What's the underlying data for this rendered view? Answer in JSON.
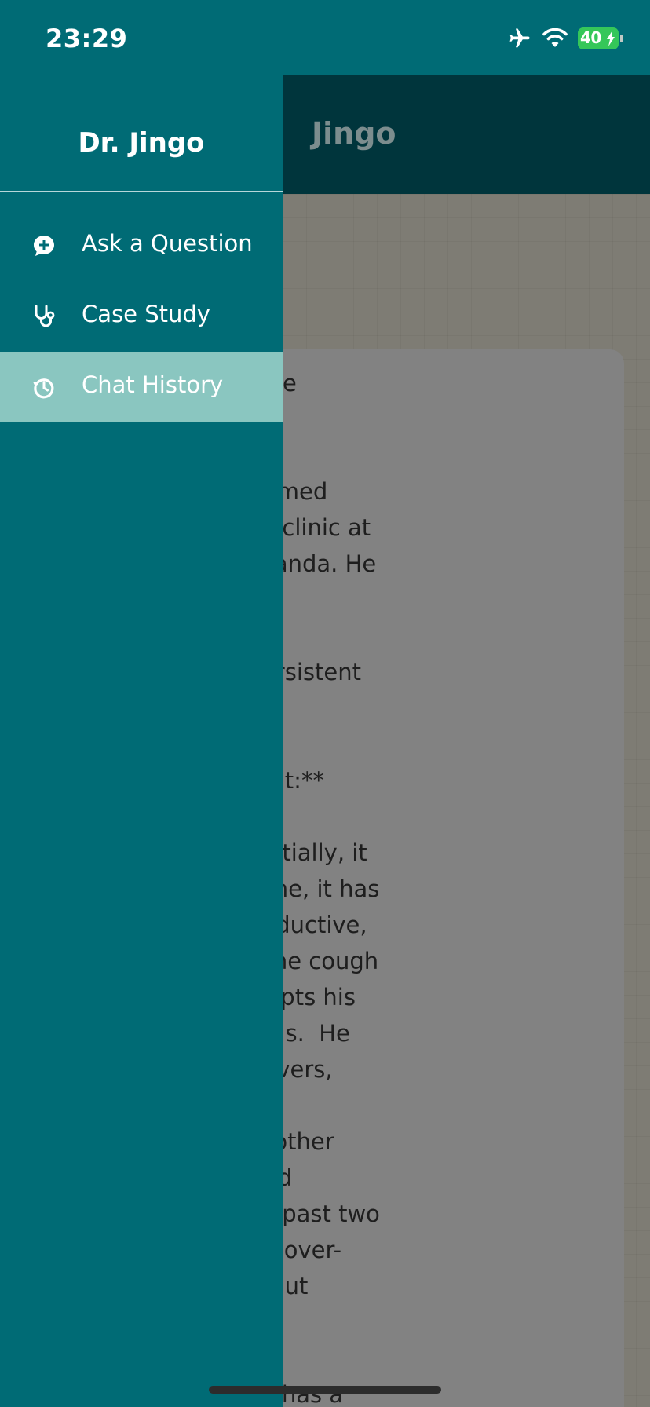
{
  "status_bar": {
    "time": "23:29",
    "battery_percent": "40",
    "icons": [
      "airplane-icon",
      "wifi-icon",
      "battery-icon"
    ]
  },
  "app_bar": {
    "title": "Jingo"
  },
  "case": {
    "paragraphs": [
      "ase: The Case of the\nugh",
      "10-year-old boy named\ns to the outpatient clinic at\nspital in Mbale, Uganda. He\nied by his mother.",
      "Complaint:**  A persistent\n past 3 months.",
      "resenting Complaint:**\n began gradually\ny 3 months ago. Initially, it\nnfrequent. Over time, it has\ne frequent and productive,\nn-green sputum. The cough\nght and often disrupts his\nnies any hemoptysis.  He\nced intermittent fevers,\nthe evenings, with\nght sweats.  His mother\nreased appetite and\neight loss over the past two\n have tried various over-\ncough syrups without\nprovement.",
      "al History:**  Musa has a"
    ]
  },
  "drawer": {
    "title": "Dr. Jingo",
    "items": [
      {
        "label": "Ask a Question",
        "icon": "chat-plus-icon",
        "active": false
      },
      {
        "label": "Case Study",
        "icon": "stethoscope-icon",
        "active": false
      },
      {
        "label": "Chat History",
        "icon": "history-icon",
        "active": true
      }
    ]
  },
  "colors": {
    "drawer": "#006b75",
    "active_item": "#8ac6c0",
    "app_bar_dimmed": "#00353c",
    "battery": "#35c759"
  }
}
